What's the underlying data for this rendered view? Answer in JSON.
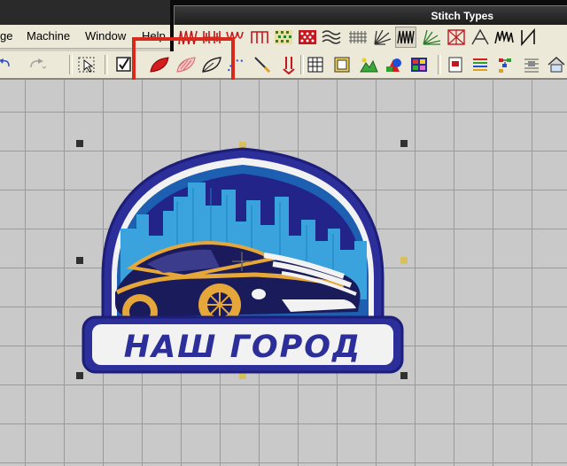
{
  "menu": {
    "items": [
      {
        "label": "ge"
      },
      {
        "label": "Machine"
      },
      {
        "label": "Window"
      },
      {
        "label": "Help"
      }
    ]
  },
  "stitch_toolbar": {
    "title": "Stitch Types",
    "buttons": [
      {
        "icon": "zigzag-stitch-icon"
      },
      {
        "icon": "satin-stitch-icon"
      },
      {
        "icon": "wave-stitch-icon"
      },
      {
        "icon": "comb-stitch-icon"
      },
      {
        "icon": "pattern-fill-icon"
      },
      {
        "icon": "cross-fill-icon"
      },
      {
        "icon": "wavy-fill-icon"
      },
      {
        "icon": "net-fill-icon"
      },
      {
        "icon": "radial-stitch-icon"
      },
      {
        "icon": "zigzag-fill-icon"
      },
      {
        "icon": "fan-stitch-icon"
      },
      {
        "icon": "cross-hatch-icon"
      },
      {
        "icon": "triangle-stitch-icon"
      },
      {
        "icon": "jagged-stitch-icon"
      },
      {
        "icon": "column-stitch-icon"
      }
    ]
  },
  "colors": {
    "highlight": "#d8291d",
    "patch_border": "#2c2e9a",
    "patch_sky": "#1d5fb0",
    "patch_city": "#3aa3de",
    "car_orange": "#e5a63a",
    "patch_white": "#f2f2f2"
  },
  "design": {
    "patch_text": "НАШ ГОРОД"
  }
}
